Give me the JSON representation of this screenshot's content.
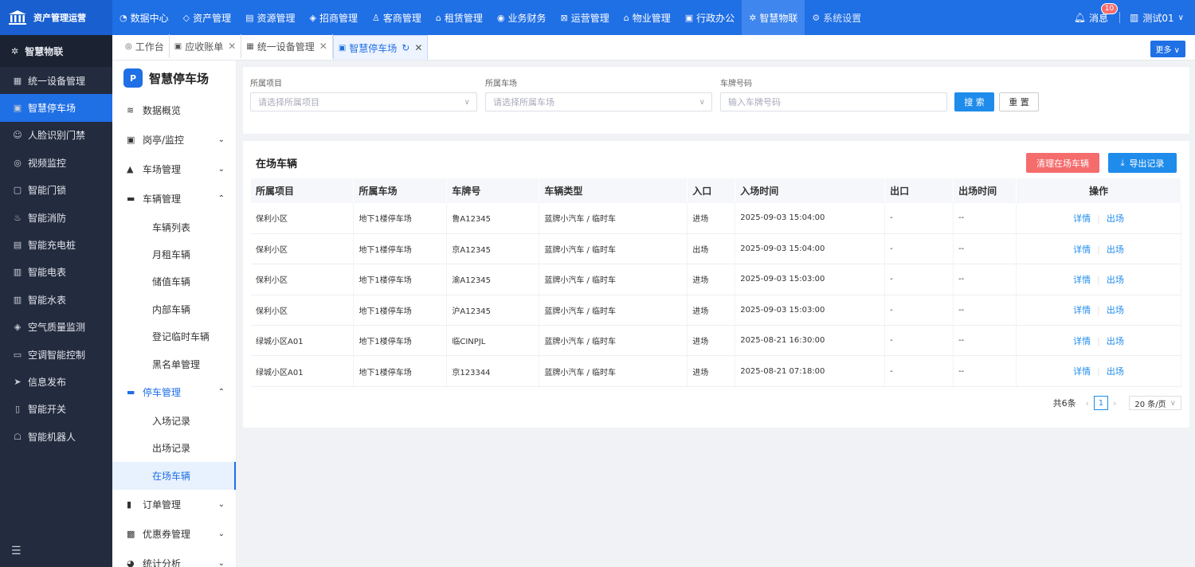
{
  "app": {
    "brand": "资产管理运营"
  },
  "topnav": [
    {
      "icon": "◔",
      "label": "数据中心"
    },
    {
      "icon": "◇",
      "label": "资产管理"
    },
    {
      "icon": "▤",
      "label": "资源管理"
    },
    {
      "icon": "◈",
      "label": "招商管理"
    },
    {
      "icon": "♙",
      "label": "客商管理"
    },
    {
      "icon": "⌂",
      "label": "租赁管理"
    },
    {
      "icon": "◉",
      "label": "业务财务"
    },
    {
      "icon": "⊠",
      "label": "运营管理"
    },
    {
      "icon": "⌂",
      "label": "物业管理"
    },
    {
      "icon": "▣",
      "label": "行政办公"
    },
    {
      "icon": "✲",
      "label": "智慧物联"
    },
    {
      "icon": "⚙",
      "label": "系统设置"
    }
  ],
  "header": {
    "messages_label": "消息",
    "messages_count": "10",
    "user_label": "测试01"
  },
  "sidebar": {
    "head": "智慧物联",
    "items": [
      {
        "icon": "▦",
        "label": "统一设备管理"
      },
      {
        "icon": "▣",
        "label": "智慧停车场"
      },
      {
        "icon": "☺",
        "label": "人脸识别门禁"
      },
      {
        "icon": "◎",
        "label": "视频监控"
      },
      {
        "icon": "▢",
        "label": "智能门锁"
      },
      {
        "icon": "♨",
        "label": "智能消防"
      },
      {
        "icon": "▤",
        "label": "智能充电桩"
      },
      {
        "icon": "▥",
        "label": "智能电表"
      },
      {
        "icon": "▥",
        "label": "智能水表"
      },
      {
        "icon": "◈",
        "label": "空气质量监测"
      },
      {
        "icon": "▭",
        "label": "空调智能控制"
      },
      {
        "icon": "➤",
        "label": "信息发布"
      },
      {
        "icon": "▯",
        "label": "智能开关"
      },
      {
        "icon": "☖",
        "label": "智能机器人"
      }
    ]
  },
  "tabs": [
    {
      "icon": "◎",
      "label": "工作台",
      "closable": false
    },
    {
      "icon": "▣",
      "label": "应收账单",
      "closable": true
    },
    {
      "icon": "▦",
      "label": "统一设备管理",
      "closable": true
    },
    {
      "icon": "▣",
      "label": "智慧停车场",
      "closable": true
    }
  ],
  "more_label": "更多 ∨",
  "subnav": {
    "title": "智慧停车场",
    "title_icon": "P",
    "groups": [
      {
        "icon": "≋",
        "label": "数据概览"
      },
      {
        "icon": "▣",
        "label": "岗亭/监控"
      },
      {
        "icon": "▲",
        "label": "车场管理"
      },
      {
        "icon": "▬",
        "label": "车辆管理"
      },
      {
        "icon": "▬",
        "label": "停车管理"
      },
      {
        "icon": "▮",
        "label": "订单管理"
      },
      {
        "icon": "▩",
        "label": "优惠券管理"
      },
      {
        "icon": "◕",
        "label": "统计分析"
      }
    ],
    "vehicle_items": [
      "车辆列表",
      "月租车辆",
      "储值车辆",
      "内部车辆",
      "登记临时车辆",
      "黑名单管理"
    ],
    "parking_items": [
      "入场记录",
      "出场记录",
      "在场车辆"
    ]
  },
  "filters": {
    "project_label": "所属项目",
    "project_placeholder": "请选择所属项目",
    "lot_label": "所属车场",
    "lot_placeholder": "请选择所属车场",
    "plate_label": "车牌号码",
    "plate_placeholder": "输入车牌号码",
    "search_label": "搜 索",
    "reset_label": "重 置"
  },
  "table_section": {
    "title": "在场车辆",
    "clear_label": "清理在场车辆",
    "export_label": "导出记录",
    "columns": [
      "所属项目",
      "所属车场",
      "车牌号",
      "车辆类型",
      "入口",
      "入场时间",
      "出口",
      "出场时间",
      "操作"
    ],
    "rows": [
      {
        "project": "保利小区",
        "lot": "地下1楼停车场",
        "plate": "鲁A12345",
        "type": "蓝牌小汽车 / 临时车",
        "entry": "进场",
        "entry_time": "2025-09-03 15:04:00",
        "exit": "-",
        "exit_time": "--"
      },
      {
        "project": "保利小区",
        "lot": "地下1楼停车场",
        "plate": "京A12345",
        "type": "蓝牌小汽车 / 临时车",
        "entry": "出场",
        "entry_time": "2025-09-03 15:04:00",
        "exit": "-",
        "exit_time": "--"
      },
      {
        "project": "保利小区",
        "lot": "地下1楼停车场",
        "plate": "渝A12345",
        "type": "蓝牌小汽车 / 临时车",
        "entry": "进场",
        "entry_time": "2025-09-03 15:03:00",
        "exit": "-",
        "exit_time": "--"
      },
      {
        "project": "保利小区",
        "lot": "地下1楼停车场",
        "plate": "沪A12345",
        "type": "蓝牌小汽车 / 临时车",
        "entry": "进场",
        "entry_time": "2025-09-03 15:03:00",
        "exit": "-",
        "exit_time": "--"
      },
      {
        "project": "绿城小区A01",
        "lot": "地下1楼停车场",
        "plate": "临CINPJL",
        "type": "蓝牌小汽车 / 临时车",
        "entry": "进场",
        "entry_time": "2025-08-21 16:30:00",
        "exit": "-",
        "exit_time": "--"
      },
      {
        "project": "绿城小区A01",
        "lot": "地下1楼停车场",
        "plate": "京123344",
        "type": "蓝牌小汽车 / 临时车",
        "entry": "进场",
        "entry_time": "2025-08-21 07:18:00",
        "exit": "-",
        "exit_time": "--"
      }
    ],
    "action_detail": "详情",
    "action_exit": "出场"
  },
  "pager": {
    "total": "共6条",
    "page": "1",
    "size": "20 条/页"
  },
  "colors": {
    "primary": "#1f6fe5",
    "danger": "#f56c6c",
    "sidebar_bg": "#232b3e"
  }
}
